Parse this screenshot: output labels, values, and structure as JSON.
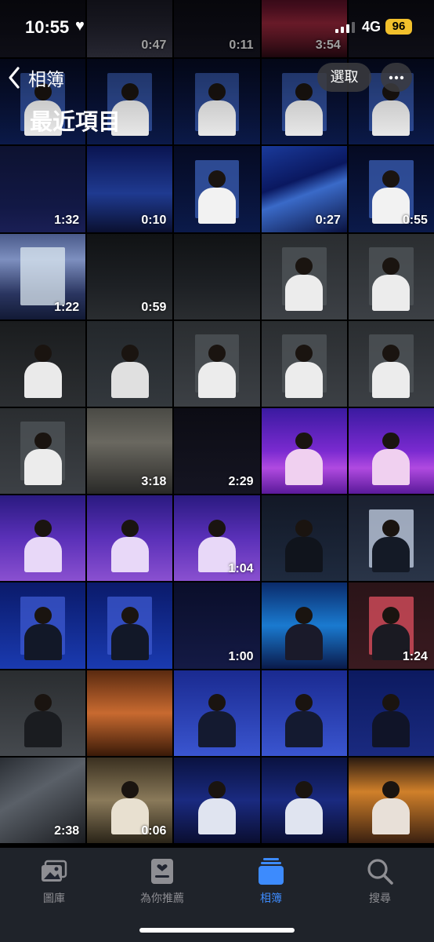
{
  "status_bar": {
    "time": "10:55",
    "heart": "♥",
    "network": "4G",
    "battery": "96"
  },
  "header": {
    "back_label": "相簿",
    "select_label": "選取",
    "more_icon": "ellipsis-icon",
    "title": "最近項目"
  },
  "grid": {
    "columns": 5,
    "items": [
      {
        "t": "video",
        "d": "",
        "s": "dark"
      },
      {
        "t": "video",
        "d": "0:47",
        "s": "crowd"
      },
      {
        "t": "video",
        "d": "0:11",
        "s": "dark"
      },
      {
        "t": "video",
        "d": "3:54",
        "s": "red"
      },
      {
        "t": "photo",
        "d": "",
        "s": "dark"
      },
      {
        "t": "photo",
        "d": "",
        "s": "screen-blue"
      },
      {
        "t": "photo",
        "d": "",
        "s": "screen-blue"
      },
      {
        "t": "photo",
        "d": "",
        "s": "screen-blue"
      },
      {
        "t": "photo",
        "d": "",
        "s": "screen-blue"
      },
      {
        "t": "photo",
        "d": "",
        "s": "screen-blue"
      },
      {
        "t": "video",
        "d": "1:32",
        "s": "night"
      },
      {
        "t": "video",
        "d": "0:10",
        "s": "stage-blue"
      },
      {
        "t": "photo",
        "d": "",
        "s": "screen-blue"
      },
      {
        "t": "video",
        "d": "0:27",
        "s": "beams"
      },
      {
        "t": "video",
        "d": "0:55",
        "s": "screen-blue"
      },
      {
        "t": "video",
        "d": "1:22",
        "s": "bright"
      },
      {
        "t": "video",
        "d": "0:59",
        "s": "dark-stage"
      },
      {
        "t": "photo",
        "d": "",
        "s": "dark-stage"
      },
      {
        "t": "photo",
        "d": "",
        "s": "portrait-gray"
      },
      {
        "t": "photo",
        "d": "",
        "s": "portrait-gray"
      },
      {
        "t": "photo",
        "d": "",
        "s": "portrait-dark"
      },
      {
        "t": "photo",
        "d": "",
        "s": "fullbody"
      },
      {
        "t": "photo",
        "d": "",
        "s": "portrait-gray"
      },
      {
        "t": "photo",
        "d": "",
        "s": "portrait-gray"
      },
      {
        "t": "photo",
        "d": "",
        "s": "portrait-gray"
      },
      {
        "t": "photo",
        "d": "",
        "s": "portrait-gray"
      },
      {
        "t": "video",
        "d": "3:18",
        "s": "arena"
      },
      {
        "t": "video",
        "d": "2:29",
        "s": "dark"
      },
      {
        "t": "photo",
        "d": "",
        "s": "purple-dance"
      },
      {
        "t": "photo",
        "d": "",
        "s": "purple-dance"
      },
      {
        "t": "photo",
        "d": "",
        "s": "purple-portrait"
      },
      {
        "t": "photo",
        "d": "",
        "s": "purple-portrait"
      },
      {
        "t": "video",
        "d": "1:04",
        "s": "purple-portrait"
      },
      {
        "t": "photo",
        "d": "",
        "s": "leather"
      },
      {
        "t": "photo",
        "d": "",
        "s": "leather-light"
      },
      {
        "t": "photo",
        "d": "",
        "s": "blue-leather"
      },
      {
        "t": "photo",
        "d": "",
        "s": "blue-leather"
      },
      {
        "t": "video",
        "d": "1:00",
        "s": "navy"
      },
      {
        "t": "photo",
        "d": "",
        "s": "cyan-stage"
      },
      {
        "t": "video",
        "d": "1:24",
        "s": "red-screen"
      },
      {
        "t": "photo",
        "d": "",
        "s": "hat-gray"
      },
      {
        "t": "photo",
        "d": "",
        "s": "orange"
      },
      {
        "t": "photo",
        "d": "",
        "s": "hat-blue"
      },
      {
        "t": "photo",
        "d": "",
        "s": "hat-blue"
      },
      {
        "t": "photo",
        "d": "",
        "s": "hat-blue-dark"
      },
      {
        "t": "video",
        "d": "2:38",
        "s": "haze"
      },
      {
        "t": "video",
        "d": "0:06",
        "s": "tan"
      },
      {
        "t": "photo",
        "d": "",
        "s": "group-dance"
      },
      {
        "t": "photo",
        "d": "",
        "s": "group-dance"
      },
      {
        "t": "photo",
        "d": "",
        "s": "group-orange"
      }
    ]
  },
  "tab_bar": {
    "tabs": [
      {
        "label": "圖庫",
        "icon": "photos-icon",
        "active": false
      },
      {
        "label": "為你推薦",
        "icon": "for-you-icon",
        "active": false
      },
      {
        "label": "相簿",
        "icon": "albums-icon",
        "active": true
      },
      {
        "label": "搜尋",
        "icon": "search-icon",
        "active": false
      }
    ]
  },
  "colors": {
    "accent": "#3d8bfd",
    "battery": "#f2c02c",
    "inactive": "#8e8e93"
  }
}
